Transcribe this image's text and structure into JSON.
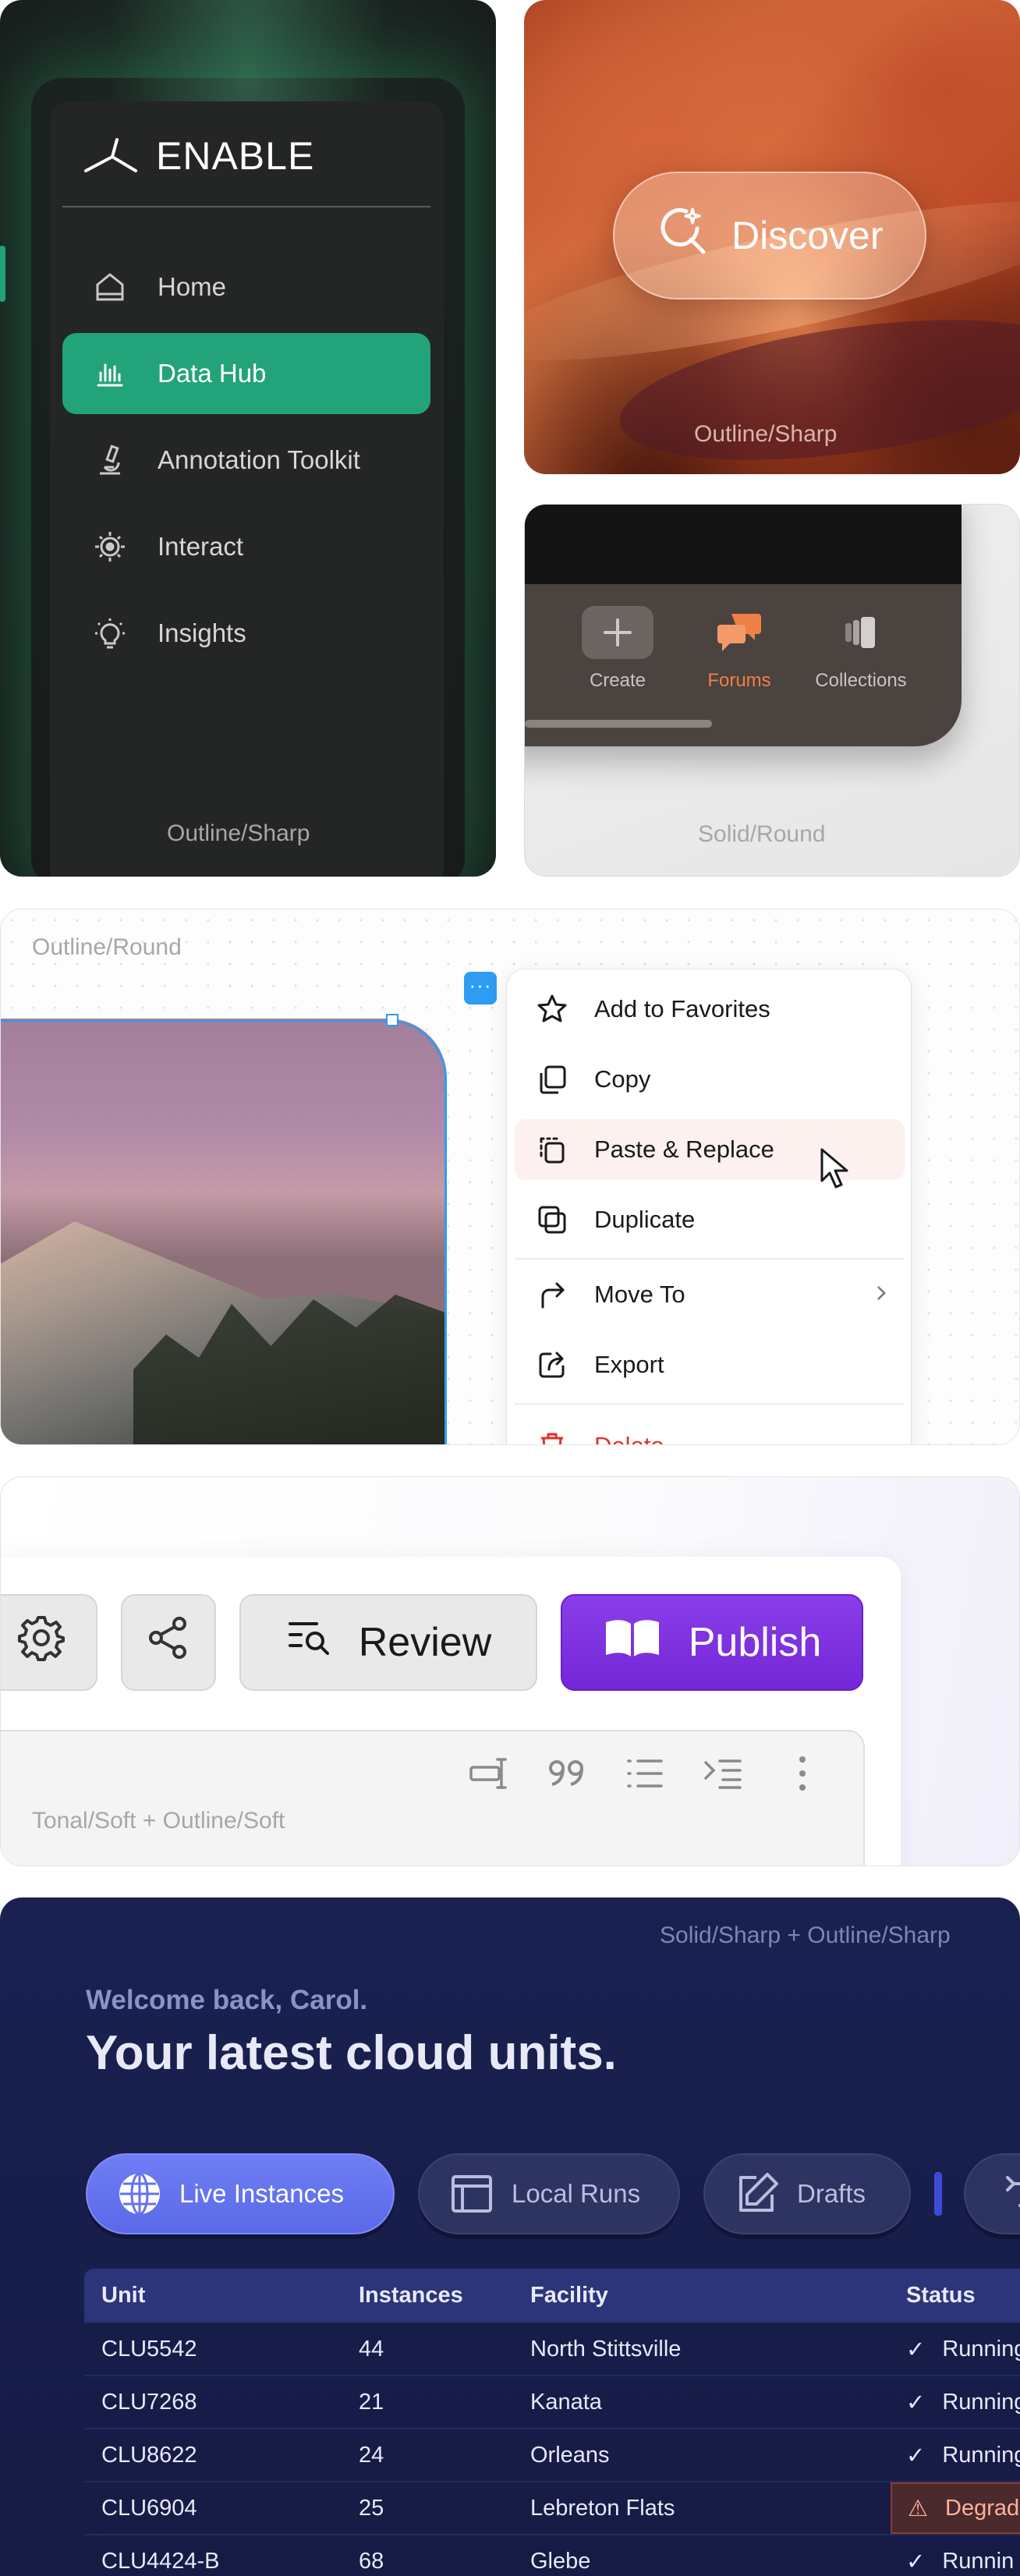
{
  "nav_card": {
    "brand": "ENABLE",
    "items": [
      {
        "label": "Home",
        "icon": "home-icon"
      },
      {
        "label": "Data Hub",
        "icon": "data-hub-icon",
        "active": true
      },
      {
        "label": "Annotation Toolkit",
        "icon": "microscope-icon"
      },
      {
        "label": "Interact",
        "icon": "target-icon"
      },
      {
        "label": "Insights",
        "icon": "lightbulb-icon"
      }
    ],
    "style_label": "Outline/Sharp",
    "accent": "#23a37a"
  },
  "canyon_card": {
    "button_label": "Discover",
    "button_icon": "sparkle-search-icon",
    "style_label": "Outline/Sharp"
  },
  "tabbar_card": {
    "tabs": [
      {
        "label": "Create",
        "icon": "plus-icon"
      },
      {
        "label": "Forums",
        "icon": "chat-bubbles-icon",
        "active": true
      },
      {
        "label": "Collections",
        "icon": "collections-icon"
      }
    ],
    "style_label": "Solid/Round",
    "accent": "#f07f45"
  },
  "menu_card": {
    "style_label": "Outline/Round",
    "more_chip": "···",
    "items": [
      {
        "label": "Add to Favorites",
        "icon": "star-icon"
      },
      {
        "label": "Copy",
        "icon": "copy-icon"
      },
      {
        "label": "Paste & Replace",
        "icon": "paste-icon"
      },
      {
        "label": "Duplicate",
        "icon": "duplicate-icon"
      },
      {
        "label": "Move To",
        "icon": "forward-arrow-icon"
      },
      {
        "label": "Export",
        "icon": "export-icon"
      },
      {
        "label": "Delete",
        "icon": "trash-icon"
      }
    ]
  },
  "toolbar_card": {
    "review_label": "Review",
    "publish_label": "Publish",
    "style_label": "Tonal/Soft + Outline/Soft",
    "accent": "#7c2fe0"
  },
  "dashboard_card": {
    "style_label": "Solid/Sharp + Outline/Sharp",
    "welcome": "Welcome back, Carol.",
    "headline": "Your latest cloud units.",
    "chips": [
      {
        "label": "Live Instances",
        "icon": "globe-icon",
        "active": true
      },
      {
        "label": "Local Runs",
        "icon": "window-icon"
      },
      {
        "label": "Drafts",
        "icon": "pencil-icon"
      }
    ],
    "table": {
      "headers": [
        "Unit",
        "Instances",
        "Facility",
        "Status"
      ],
      "rows": [
        {
          "unit": "CLU5542",
          "instances": "44",
          "facility": "North Stittsville",
          "status": "Running",
          "warn": false
        },
        {
          "unit": "CLU7268",
          "instances": "21",
          "facility": "Kanata",
          "status": "Running",
          "warn": false
        },
        {
          "unit": "CLU8622",
          "instances": "24",
          "facility": "Orleans",
          "status": "Running",
          "warn": false
        },
        {
          "unit": "CLU6904",
          "instances": "25",
          "facility": "Lebreton Flats",
          "status": "Degrad",
          "warn": true
        },
        {
          "unit": "CLU4424-B",
          "instances": "68",
          "facility": "Glebe",
          "status": "Runnin",
          "warn": false
        }
      ]
    }
  }
}
